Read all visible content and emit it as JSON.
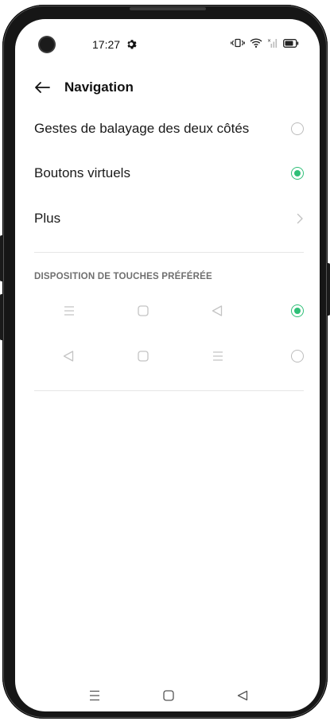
{
  "status_bar": {
    "time": "17:27",
    "icons": [
      "camera-hole",
      "gear-icon",
      "vibrate-icon",
      "wifi-icon",
      "signal-icon",
      "battery-icon"
    ]
  },
  "header": {
    "back_icon": "back-arrow-icon",
    "title": "Navigation"
  },
  "options": [
    {
      "label": "Gestes de balayage des deux côtés",
      "selected": false
    },
    {
      "label": "Boutons virtuels",
      "selected": true
    },
    {
      "label": "Plus",
      "type": "chevron"
    }
  ],
  "layout_section": {
    "title": "DISPOSITION DE TOUCHES PRÉFÉRÉE",
    "layouts": [
      {
        "keys": [
          "menu",
          "home",
          "back"
        ],
        "selected": true
      },
      {
        "keys": [
          "back",
          "home",
          "menu"
        ],
        "selected": false
      }
    ]
  },
  "system_nav": {
    "keys": [
      "menu",
      "home",
      "back"
    ]
  },
  "colors": {
    "accent": "#2fbf77",
    "muted_icon": "#c4c4c4",
    "divider": "#e6e6e6"
  }
}
